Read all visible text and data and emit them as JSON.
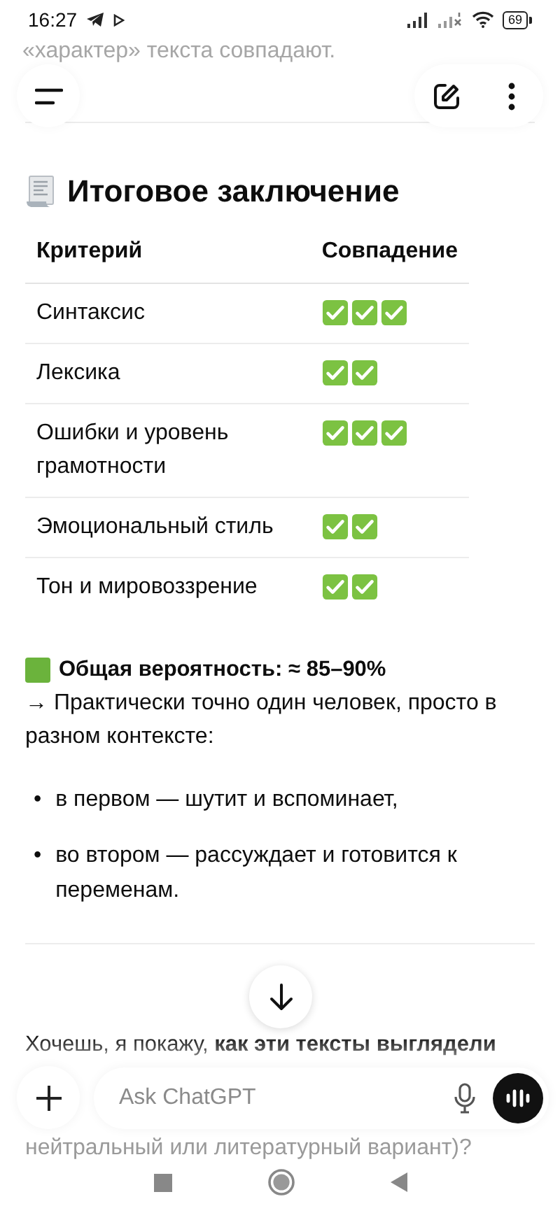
{
  "status_bar": {
    "time": "16:27",
    "battery": "69"
  },
  "faded_top": "«характер» текста совпадают.",
  "heading": "Итоговое заключение",
  "table": {
    "columns": [
      "Критерий",
      "Совпадение"
    ],
    "rows": [
      {
        "criterion": "Синтаксис",
        "marks": [
          {
            "checked": true
          },
          {
            "checked": true
          },
          {
            "checked": true
          }
        ]
      },
      {
        "criterion": "Лексика",
        "marks": [
          {
            "checked": true
          },
          {
            "checked": true
          }
        ]
      },
      {
        "criterion": "Ошибки и уровень грамотности",
        "marks": [
          {
            "checked": true
          },
          {
            "checked": true
          },
          {
            "checked": true
          }
        ]
      },
      {
        "criterion": "Эмоциональный стиль",
        "marks": [
          {
            "checked": true
          },
          {
            "checked": true
          }
        ]
      },
      {
        "criterion": "Тон и мировоззрение",
        "marks": [
          {
            "checked": true
          },
          {
            "checked": true
          }
        ]
      }
    ]
  },
  "probability": "Общая вероятность: ≈ 85–90%",
  "conclusion": "→ Практически точно один человек, просто в разном контексте:",
  "bullets": [
    {
      "marker": "•",
      "text": "в первом — шутит и вспоминает,"
    },
    {
      "marker": "•",
      "text": "во втором — рассуждает и готовится к переменам."
    }
  ],
  "question": "Хочешь, я покажу, **как эти тексты выглядели**",
  "composer": {
    "placeholder": "Ask ChatGPT"
  },
  "faded_bottom": "нейтральный или литературный вариант)?"
}
